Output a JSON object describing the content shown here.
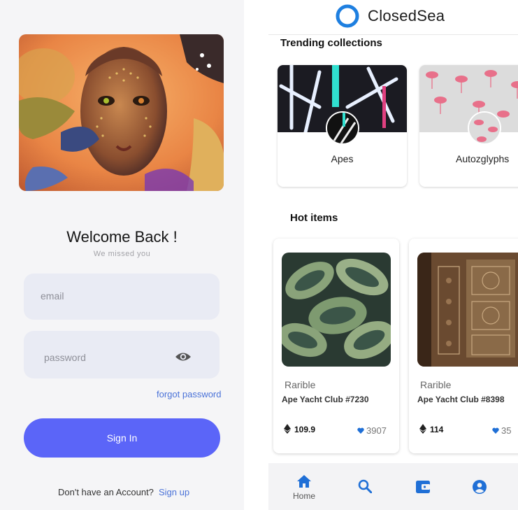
{
  "login": {
    "welcome_title": "Welcome Back !",
    "welcome_subtitle": "We missed you",
    "email_placeholder": "email",
    "password_placeholder": "password",
    "forgot_password": "forgot password",
    "signin_label": "Sign In",
    "no_account_text": "Don't have an Account?",
    "signup_link": "Sign up"
  },
  "market": {
    "brand": "ClosedSea",
    "trending_title": "Trending collections",
    "collections": [
      {
        "name": "Apes"
      },
      {
        "name": "Autozglyphs"
      }
    ],
    "hot_title": "Hot items",
    "items": [
      {
        "creator": "Rarible",
        "title": "Ape Yacht Club #7230",
        "price": "109.9",
        "likes": "3907"
      },
      {
        "creator": "Rarible",
        "title": "Ape Yacht Club #8398",
        "price": "114",
        "likes": "35"
      }
    ],
    "nav": {
      "home_label": "Home",
      "icons": [
        "home-icon",
        "search-icon",
        "wallet-icon",
        "account-icon"
      ]
    }
  },
  "colors": {
    "primary_button": "#5b65f8",
    "link": "#4a72d8",
    "logo_blue": "#1e7fe0",
    "nav_blue": "#1f6fd6"
  }
}
